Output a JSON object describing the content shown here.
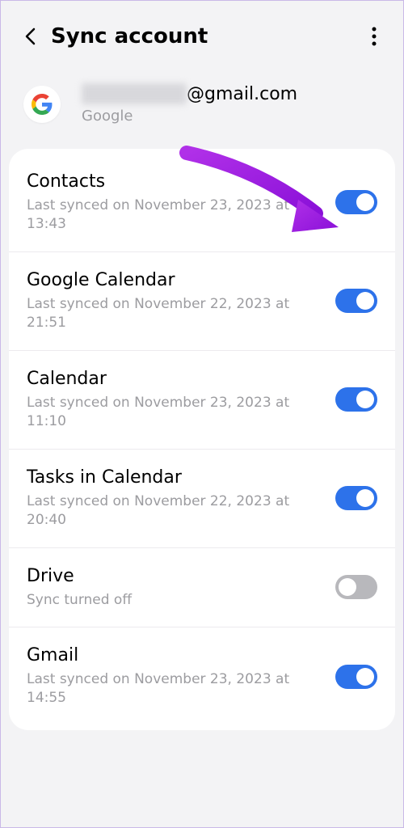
{
  "header": {
    "title": "Sync account"
  },
  "account": {
    "email_suffix": "@gmail.com",
    "provider": "Google"
  },
  "items": [
    {
      "title": "Contacts",
      "sub": "Last synced on November 23, 2023 at 13:43",
      "on": true
    },
    {
      "title": "Google Calendar",
      "sub": "Last synced on November 22, 2023 at 21:51",
      "on": true
    },
    {
      "title": "Calendar",
      "sub": "Last synced on November 23, 2023 at 11:10",
      "on": true
    },
    {
      "title": "Tasks in Calendar",
      "sub": "Last synced on November 22, 2023 at 20:40",
      "on": true
    },
    {
      "title": "Drive",
      "sub": "Sync turned off",
      "on": false
    },
    {
      "title": "Gmail",
      "sub": "Last synced on November 23, 2023 at 14:55",
      "on": true
    }
  ]
}
